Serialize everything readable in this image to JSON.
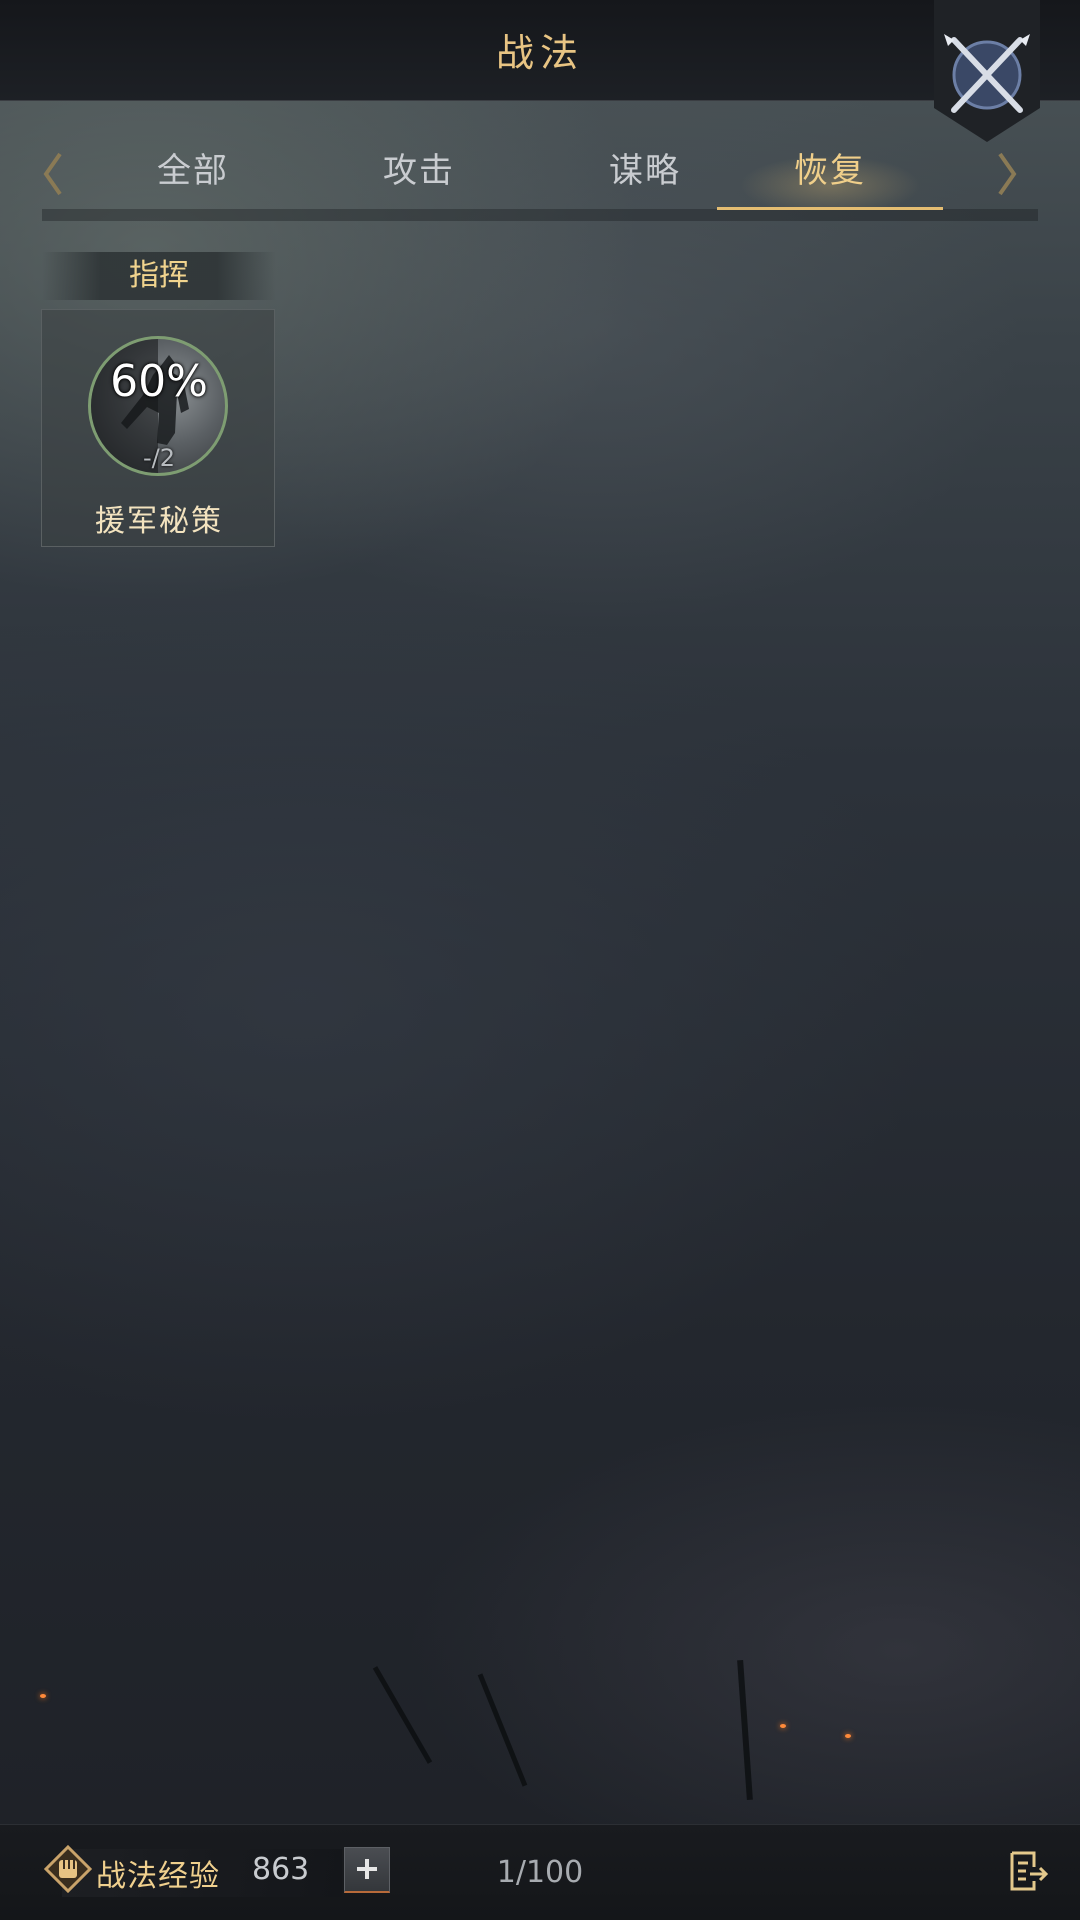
{
  "header": {
    "title": "战法"
  },
  "tabs": [
    {
      "label": "全部",
      "active": false
    },
    {
      "label": "攻击",
      "active": false
    },
    {
      "label": "谋略",
      "active": false
    },
    {
      "label": "恢复",
      "active": true
    }
  ],
  "section": {
    "label": "指挥",
    "skills": [
      {
        "name": "援军秘策",
        "percent": "60%",
        "count": "-/2",
        "progress": 0.6
      }
    ]
  },
  "footer": {
    "exp_label": "战法经验",
    "exp_value": "863",
    "add_label": "+",
    "page_count": "1/100"
  },
  "icons": {
    "close": "crossed-swords-icon",
    "exp": "fist-emblem-icon",
    "list": "list-export-icon",
    "prev": "chevron-left-icon",
    "next": "chevron-right-icon"
  },
  "colors": {
    "accent": "#e8c483",
    "tab_active": "#f0cf8a",
    "tab_inactive": "#c9ccd0",
    "ring": "#7e9d72"
  }
}
